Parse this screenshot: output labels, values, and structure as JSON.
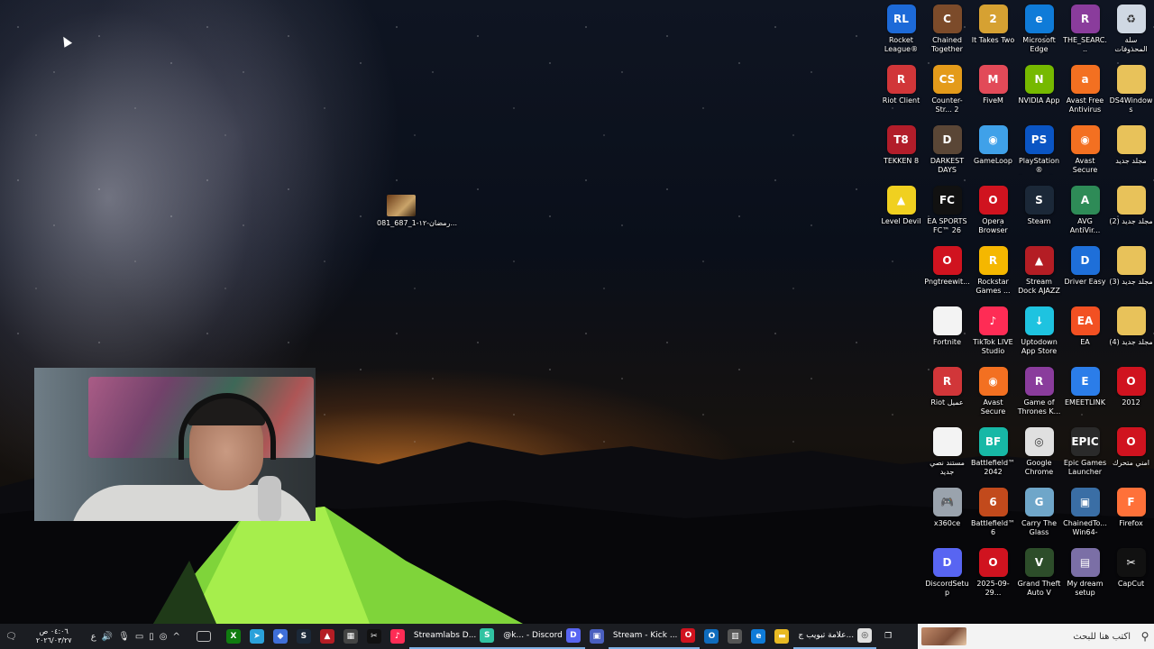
{
  "desktop": {
    "free_file": {
      "label": "رمضان-١٢-1_687_081...",
      "thumb": "image-file-icon"
    },
    "icons": [
      {
        "label": "سلة المحذوفات",
        "icon": "recycle-bin-icon",
        "bg": "#cfd8e3",
        "glyph": "♻"
      },
      {
        "label": "DS4Windows",
        "icon": "folder-icon",
        "bg": "#e8c25a",
        "glyph": ""
      },
      {
        "label": "مجلد جديد",
        "icon": "folder-icon",
        "bg": "#e8c25a",
        "glyph": ""
      },
      {
        "label": "مجلد جديد (2)",
        "icon": "folder-icon",
        "bg": "#e8c25a",
        "glyph": ""
      },
      {
        "label": "مجلد جديد (3)",
        "icon": "folder-icon",
        "bg": "#e8c25a",
        "glyph": ""
      },
      {
        "label": "مجلد جديد (4)",
        "icon": "folder-icon",
        "bg": "#e8c25a",
        "glyph": ""
      },
      {
        "label": "2012",
        "icon": "opera-icon",
        "bg": "#d0131f",
        "glyph": "O"
      },
      {
        "label": "امني متحرك",
        "icon": "opera-icon",
        "bg": "#d0131f",
        "glyph": "O"
      },
      {
        "label": "Firefox",
        "icon": "firefox-icon",
        "bg": "#ff7139",
        "glyph": "F"
      },
      {
        "label": "CapCut",
        "icon": "capcut-icon",
        "bg": "#111111",
        "glyph": "✂"
      },
      {
        "label": "THE_SEARC...",
        "icon": "winrar-icon",
        "bg": "#8a3c9c",
        "glyph": "R"
      },
      {
        "label": "Avast Free Antivirus",
        "icon": "avast-icon",
        "bg": "#f37021",
        "glyph": "a"
      },
      {
        "label": "Avast Secure Browser",
        "icon": "avast-browser-icon",
        "bg": "#f37021",
        "glyph": "◉"
      },
      {
        "label": "AVG AntiVir...",
        "icon": "avg-icon",
        "bg": "#2e8b57",
        "glyph": "A"
      },
      {
        "label": "Driver Easy",
        "icon": "driver-easy-icon",
        "bg": "#1e6fd9",
        "glyph": "D"
      },
      {
        "label": "EA",
        "icon": "ea-icon",
        "bg": "#f25022",
        "glyph": "EA"
      },
      {
        "label": "EMEETLINK",
        "icon": "emeetlink-icon",
        "bg": "#2b7de9",
        "glyph": "E"
      },
      {
        "label": "Epic Games Launcher",
        "icon": "epic-games-icon",
        "bg": "#2a2a2a",
        "glyph": "EPIC"
      },
      {
        "label": "ChainedTo... Win64-Ship...",
        "icon": "shortcut-icon",
        "bg": "#3a6ea5",
        "glyph": "▣"
      },
      {
        "label": "My dream setup",
        "icon": "image-icon",
        "bg": "#7b6fa6",
        "glyph": "▤"
      },
      {
        "label": "Microsoft Edge",
        "icon": "edge-icon",
        "bg": "#0f7bd8",
        "glyph": "e"
      },
      {
        "label": "NVIDIA App",
        "icon": "nvidia-icon",
        "bg": "#76b900",
        "glyph": "N"
      },
      {
        "label": "PlayStation® Accessories",
        "icon": "playstation-icon",
        "bg": "#0a55c4",
        "glyph": "PS"
      },
      {
        "label": "Steam",
        "icon": "steam-icon",
        "bg": "#1b2838",
        "glyph": "S"
      },
      {
        "label": "Stream Dock AJAZZ",
        "icon": "stream-dock-icon",
        "bg": "#b41d24",
        "glyph": "▲"
      },
      {
        "label": "Uptodown App Store",
        "icon": "uptodown-icon",
        "bg": "#1ec3e0",
        "glyph": "↓"
      },
      {
        "label": "Game of Thrones K...",
        "icon": "winrar-icon",
        "bg": "#8a3c9c",
        "glyph": "R"
      },
      {
        "label": "Google Chrome",
        "icon": "chrome-icon",
        "bg": "#e0e0e0",
        "glyph": "◎"
      },
      {
        "label": "Carry The Glass",
        "icon": "game-icon",
        "bg": "#6fa6c9",
        "glyph": "G"
      },
      {
        "label": "Grand Theft Auto V",
        "icon": "gta-icon",
        "bg": "#2d4d2a",
        "glyph": "V"
      },
      {
        "label": "It Takes Two",
        "icon": "it-takes-two-icon",
        "bg": "#d6a132",
        "glyph": "2"
      },
      {
        "label": "FiveM",
        "icon": "fivem-icon",
        "bg": "#e24a58",
        "glyph": "M"
      },
      {
        "label": "GameLoop",
        "icon": "gameloop-icon",
        "bg": "#3fa1e9",
        "glyph": "◉"
      },
      {
        "label": "Opera Browser",
        "icon": "opera-icon",
        "bg": "#d0131f",
        "glyph": "O"
      },
      {
        "label": "Rockstar Games ...",
        "icon": "rockstar-icon",
        "bg": "#f5b700",
        "glyph": "R"
      },
      {
        "label": "TikTok LIVE Studio",
        "icon": "tiktok-icon",
        "bg": "#fe2c55",
        "glyph": "♪"
      },
      {
        "label": "Avast Secure Browser",
        "icon": "avast-browser-icon",
        "bg": "#f37021",
        "glyph": "◉"
      },
      {
        "label": "Battlefield™ 2042",
        "icon": "battlefield-icon",
        "bg": "#17b8a6",
        "glyph": "BF"
      },
      {
        "label": "Battlefield™ 6",
        "icon": "battlefield-icon",
        "bg": "#c24a1c",
        "glyph": "6"
      },
      {
        "label": "2025-09-29...",
        "icon": "opera-icon",
        "bg": "#d0131f",
        "glyph": "O"
      },
      {
        "label": "Chained Together",
        "icon": "game-icon",
        "bg": "#7c4b2a",
        "glyph": "C"
      },
      {
        "label": "Counter-Str... 2",
        "icon": "counter-strike-icon",
        "bg": "#e49b1a",
        "glyph": "CS"
      },
      {
        "label": "DARKEST DAYS",
        "icon": "game-icon",
        "bg": "#5a4636",
        "glyph": "D"
      },
      {
        "label": "EA SPORTS FC™ 26",
        "icon": "ea-fc-icon",
        "bg": "#111111",
        "glyph": "FC"
      },
      {
        "label": "Pngtreewit...",
        "icon": "opera-icon",
        "bg": "#d0131f",
        "glyph": "O"
      },
      {
        "label": "Fortnite",
        "icon": "file-icon",
        "bg": "#f3f3f3",
        "glyph": ""
      },
      {
        "label": "Riot عميل",
        "icon": "riot-icon",
        "bg": "#d13639",
        "glyph": "R"
      },
      {
        "label": "مستند نصي جديد",
        "icon": "text-file-icon",
        "bg": "#f3f3f3",
        "glyph": ""
      },
      {
        "label": "x360ce",
        "icon": "gamepad-icon",
        "bg": "#9aa3ad",
        "glyph": "🎮"
      },
      {
        "label": "DiscordSetup",
        "icon": "discord-icon",
        "bg": "#5865f2",
        "glyph": "D"
      },
      {
        "label": "Rocket League®",
        "icon": "rocket-league-icon",
        "bg": "#1d6ad8",
        "glyph": "RL"
      },
      {
        "label": "Riot Client",
        "icon": "riot-icon",
        "bg": "#d13639",
        "glyph": "R"
      },
      {
        "label": "TEKKEN 8",
        "icon": "tekken-icon",
        "bg": "#b21d2a",
        "glyph": "T8"
      },
      {
        "label": "Level Devil",
        "icon": "game-icon",
        "bg": "#f0d020",
        "glyph": "▲"
      }
    ]
  },
  "taskbar": {
    "clock_time": "٠٤:٠٦ ص",
    "clock_date": "٢٠٢٦/٠٣/٢٧",
    "lang": "ع",
    "apps": [
      {
        "label": "",
        "icon": "xbox-icon",
        "bg": "#107c10",
        "glyph": "X"
      },
      {
        "label": "",
        "icon": "telegram-icon",
        "bg": "#2aa1da",
        "glyph": "➤"
      },
      {
        "label": "",
        "icon": "app-icon",
        "bg": "#3f6fd8",
        "glyph": "◆"
      },
      {
        "label": "",
        "icon": "steam-icon",
        "bg": "#1b2838",
        "glyph": "S"
      },
      {
        "label": "",
        "icon": "stream-dock-icon",
        "bg": "#b41d24",
        "glyph": "▲"
      },
      {
        "label": "",
        "icon": "app-icon",
        "bg": "#444",
        "glyph": "▦"
      },
      {
        "label": "",
        "icon": "capcut-icon",
        "bg": "#111",
        "glyph": "✂"
      },
      {
        "label": "",
        "icon": "tiktok-icon",
        "bg": "#fe2c55",
        "glyph": "♪"
      },
      {
        "label": "Streamlabs D...",
        "icon": "streamlabs-icon",
        "bg": "#31c3a2",
        "glyph": "S"
      },
      {
        "label": "@k... - Discord",
        "icon": "discord-icon",
        "bg": "#5865f2",
        "glyph": "D"
      },
      {
        "label": "",
        "icon": "app-icon",
        "bg": "#4a5fbf",
        "glyph": "▣"
      },
      {
        "label": "Stream - Kick ...",
        "icon": "opera-icon",
        "bg": "#d0131f",
        "glyph": "O"
      },
      {
        "label": "",
        "icon": "outlook-icon",
        "bg": "#0f6cbd",
        "glyph": "O"
      },
      {
        "label": "",
        "icon": "store-icon",
        "bg": "#555",
        "glyph": "▥"
      },
      {
        "label": "",
        "icon": "edge-icon",
        "bg": "#0f7bd8",
        "glyph": "e"
      },
      {
        "label": "",
        "icon": "file-explorer-icon",
        "bg": "#e8b923",
        "glyph": "▬"
      },
      {
        "label": "علامة تبويب ج...",
        "icon": "chrome-icon",
        "bg": "#e0e0e0",
        "glyph": "◎"
      },
      {
        "label": "",
        "icon": "task-view-icon",
        "bg": "#1b1d22",
        "glyph": "❐"
      }
    ],
    "search_placeholder": "اكتب هنا للبحث"
  }
}
